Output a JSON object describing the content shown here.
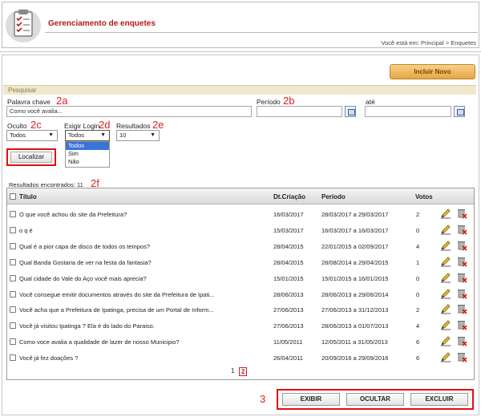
{
  "header": {
    "title": "Gerenciamento de enquetes",
    "breadcrumb": "Você está em: Principal > Enquetes"
  },
  "actions": {
    "new_label": "Incluir Novo"
  },
  "search": {
    "section_title": "Pesquisar",
    "keyword_label": "Palavra chave",
    "keyword_value": "Como você avalia...",
    "period_label": "Período",
    "until_label": "até",
    "hidden_label": "Oculto",
    "hidden_value": "Todos",
    "login_label": "Exigir Login",
    "login_value": "Todos",
    "login_options": [
      "Todos",
      "Sim",
      "Não"
    ],
    "results_label": "Resultados",
    "results_value": "10",
    "submit_label": "Localizar"
  },
  "annotations": {
    "a": "2a",
    "b": "2b",
    "c": "2c",
    "d": "2d",
    "e": "2e",
    "f": "2f",
    "three": "3"
  },
  "results": {
    "found_text": "Resultados encontrados: 11"
  },
  "table": {
    "columns": [
      "Título",
      "Dt.Criação",
      "Período",
      "Votos"
    ],
    "rows": [
      {
        "title": "O que você achou do site da Prefeitura?",
        "date": "16/03/2017",
        "period": "28/03/2017 a 29/03/2017",
        "votes": "2"
      },
      {
        "title": "o q é",
        "date": "15/03/2017",
        "period": "16/03/2017 a 16/03/2017",
        "votes": "0"
      },
      {
        "title": "Qual é a pior capa de disco de todos os tempos?",
        "date": "28/04/2015",
        "period": "22/01/2015 a 02/09/2017",
        "votes": "4"
      },
      {
        "title": "Qual Banda Gostaria de ver na festa da fantasia?",
        "date": "28/04/2015",
        "period": "28/08/2014 a 29/04/2015",
        "votes": "1"
      },
      {
        "title": "Qual cidade do Vale do Aço você mais aprecia?",
        "date": "15/01/2015",
        "period": "15/01/2015 a 16/01/2015",
        "votes": "0"
      },
      {
        "title": "Você consegue emitir documentos através do site da Prefeitura de Ipati...",
        "date": "28/06/2013",
        "period": "28/06/2013 a 29/06/2014",
        "votes": "0"
      },
      {
        "title": "Você acha que a Prefeitura de Ipatinga, precisa de um Portal de Inform...",
        "date": "27/06/2013",
        "period": "27/06/2013 a 31/12/2013",
        "votes": "2"
      },
      {
        "title": "Você já visitou Ipatinga ? Ela é do lado do Paraiso.",
        "date": "27/06/2013",
        "period": "28/06/2013 a 01/07/2013",
        "votes": "4"
      },
      {
        "title": "Como voce avalia a qualidade de lazer de nosso Municipio?",
        "date": "11/05/2011",
        "period": "12/05/2011 a 31/05/2013",
        "votes": "6"
      },
      {
        "title": "Você já fez doações ?",
        "date": "26/04/2011",
        "period": "20/09/2016 a 29/09/2016",
        "votes": "6"
      }
    ]
  },
  "pagination": {
    "page1": "1",
    "page2": "2"
  },
  "bottom": {
    "show_label": "EXIBIR",
    "hide_label": "OCULTAR",
    "delete_label": "EXCLUIR"
  },
  "colors": {
    "accent_red": "#b31b1b",
    "annotation_red": "#e02020",
    "button_orange": "#e8a743"
  }
}
